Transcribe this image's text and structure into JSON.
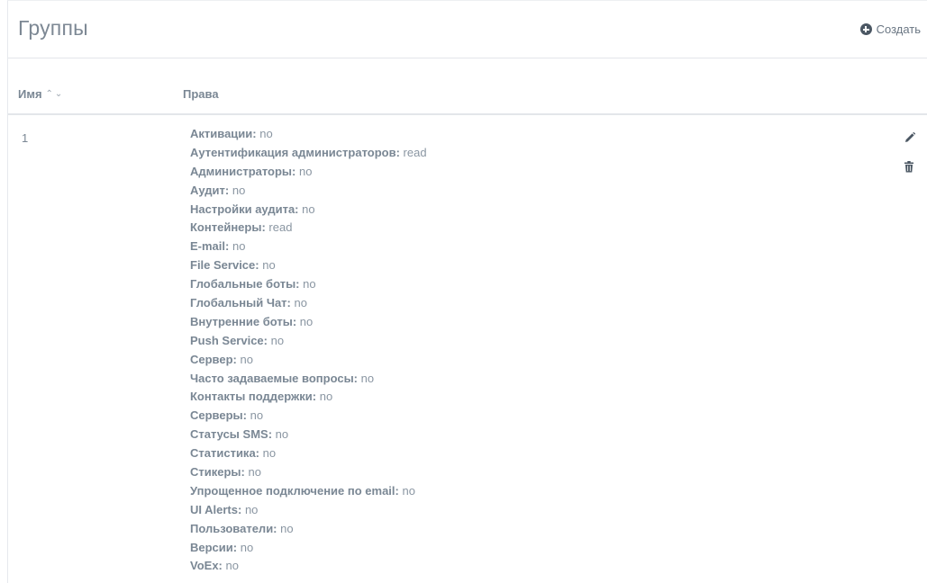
{
  "header": {
    "title": "Группы",
    "create_label": "Создать"
  },
  "table": {
    "columns": {
      "name": "Имя",
      "rights": "Права"
    },
    "rows": [
      {
        "name": "1",
        "rights": [
          {
            "label": "Активации:",
            "value": "no"
          },
          {
            "label": "Аутентификация администраторов:",
            "value": "read"
          },
          {
            "label": "Администраторы:",
            "value": "no"
          },
          {
            "label": "Аудит:",
            "value": "no"
          },
          {
            "label": "Настройки аудита:",
            "value": "no"
          },
          {
            "label": "Контейнеры:",
            "value": "read"
          },
          {
            "label": "E-mail:",
            "value": "no"
          },
          {
            "label": "File Service:",
            "value": "no"
          },
          {
            "label": "Глобальные боты:",
            "value": "no"
          },
          {
            "label": "Глобальный Чат:",
            "value": "no"
          },
          {
            "label": "Внутренние боты:",
            "value": "no"
          },
          {
            "label": "Push Service:",
            "value": "no"
          },
          {
            "label": "Сервер:",
            "value": "no"
          },
          {
            "label": "Часто задаваемые вопросы:",
            "value": "no"
          },
          {
            "label": "Контакты поддержки:",
            "value": "no"
          },
          {
            "label": "Серверы:",
            "value": "no"
          },
          {
            "label": "Статусы SMS:",
            "value": "no"
          },
          {
            "label": "Статистика:",
            "value": "no"
          },
          {
            "label": "Стикеры:",
            "value": "no"
          },
          {
            "label": "Упрощенное подключение по email:",
            "value": "no"
          },
          {
            "label": "UI Alerts:",
            "value": "no"
          },
          {
            "label": "Пользователи:",
            "value": "no"
          },
          {
            "label": "Версии:",
            "value": "no"
          },
          {
            "label": "VoEx:",
            "value": "no"
          }
        ]
      }
    ]
  },
  "icons": {
    "create": "plus-circle-icon",
    "sort": "sort-up-down-icon",
    "edit": "pencil-icon",
    "delete": "trash-icon"
  },
  "colors": {
    "text": "#7a8794",
    "border": "#e3e6ea",
    "icon_dark": "#4b5763"
  }
}
